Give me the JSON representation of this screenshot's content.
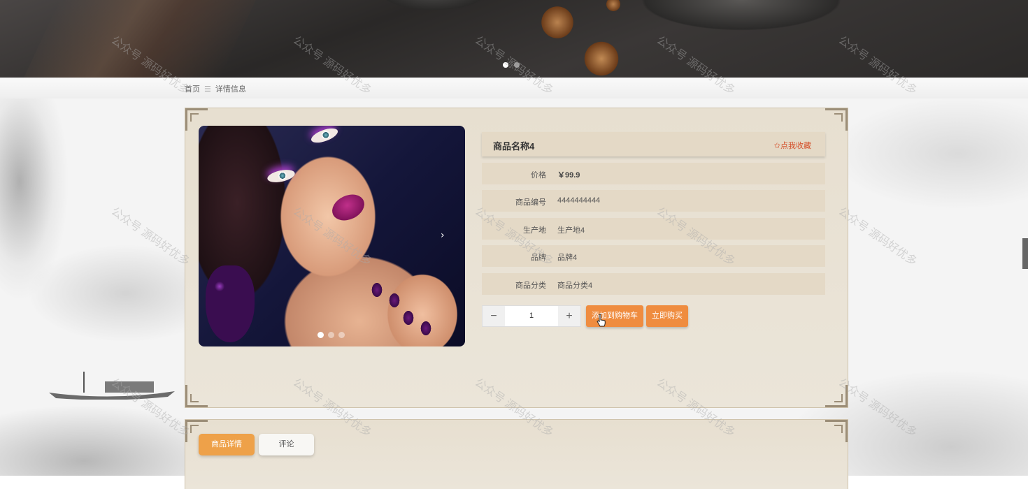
{
  "breadcrumb": {
    "home": "首页",
    "separator": "☰",
    "current": "详情信息"
  },
  "product": {
    "name": "商品名称4",
    "favorite_label": "✩点我收藏",
    "fields": [
      {
        "label": "价格",
        "value": "￥99.9"
      },
      {
        "label": "商品编号",
        "value": "4444444444"
      },
      {
        "label": "生产地",
        "value": "生产地4"
      },
      {
        "label": "品牌",
        "value": "品牌4"
      },
      {
        "label": "商品分类",
        "value": "商品分类4"
      }
    ]
  },
  "quantity": {
    "minus": "−",
    "value": "1",
    "plus": "+"
  },
  "actions": {
    "add_to_cart": "添加到购物车",
    "buy_now": "立即购买"
  },
  "tabs": [
    {
      "label": "商品详情",
      "active": true
    },
    {
      "label": "评论",
      "active": false
    }
  ],
  "carousel": {
    "next_icon": "›",
    "image_slides": 3,
    "image_active_slide": 1,
    "banner_slides": 2,
    "banner_active_slide": 1
  },
  "watermark": "公众号 源码好优多",
  "colors": {
    "accent": "#ef8c3f",
    "tab_active": "#eea149",
    "favorite": "#d4502a",
    "panel": "#e7dfd0",
    "row": "#e4d9c6"
  }
}
